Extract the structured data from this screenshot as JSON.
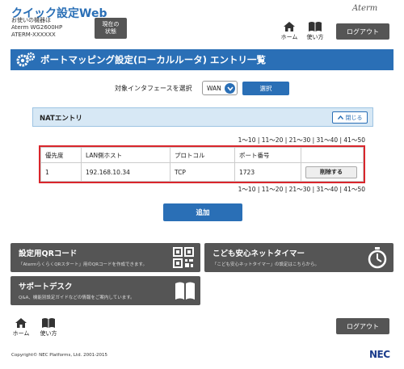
{
  "header": {
    "app_title": "クイック設定Web",
    "device_label": "お使いの機器は",
    "model": "Aterm WG2600HP",
    "device_id": "ATERM-XXXXXX",
    "status_button_line1": "現在の",
    "status_button_line2": "状態",
    "brand": "Aterm",
    "home_label": "ホーム",
    "help_label": "使い方",
    "logout_label": "ログアウト"
  },
  "page": {
    "title": "ポートマッピング設定(ローカルルータ) エントリ一覧"
  },
  "interface": {
    "label": "対象インタフェースを選択",
    "selected": "WAN",
    "select_button": "選択"
  },
  "nat_panel": {
    "label": "NATエントリ",
    "close_label": "閉じる"
  },
  "pager": {
    "text": "1～10 | 11～20 | 21～30 | 31～40 | 41～50"
  },
  "table": {
    "headers": [
      "優先度",
      "LAN側ホスト",
      "プロトコル",
      "ポート番号",
      ""
    ],
    "rows": [
      {
        "priority": "1",
        "host": "192.168.10.34",
        "protocol": "TCP",
        "port": "1723",
        "delete_label": "削除する"
      }
    ]
  },
  "add_button": "追加",
  "tiles": {
    "qr": {
      "title": "設定用QRコード",
      "desc": "「AtermらくらくQRスタート」用のQRコードを作成できます。"
    },
    "kids": {
      "title": "こども安心ネットタイマー",
      "desc": "「こども安心ネットタイマー」の設定はこちらから。"
    },
    "support": {
      "title": "サポートデスク",
      "desc": "Q&A、機能別設定ガイドなどの情報をご案内しています。"
    }
  },
  "footer": {
    "home_label": "ホーム",
    "help_label": "使い方",
    "logout_label": "ログアウト",
    "copyright": "Copyright© NEC Platforms, Ltd. 2001-2015",
    "logo": "NEC"
  },
  "colors": {
    "accent_blue": "#2a6fb6",
    "dark_gray": "#555555",
    "highlight_red": "#d9262c",
    "panel_blue": "#d7e8f5"
  }
}
